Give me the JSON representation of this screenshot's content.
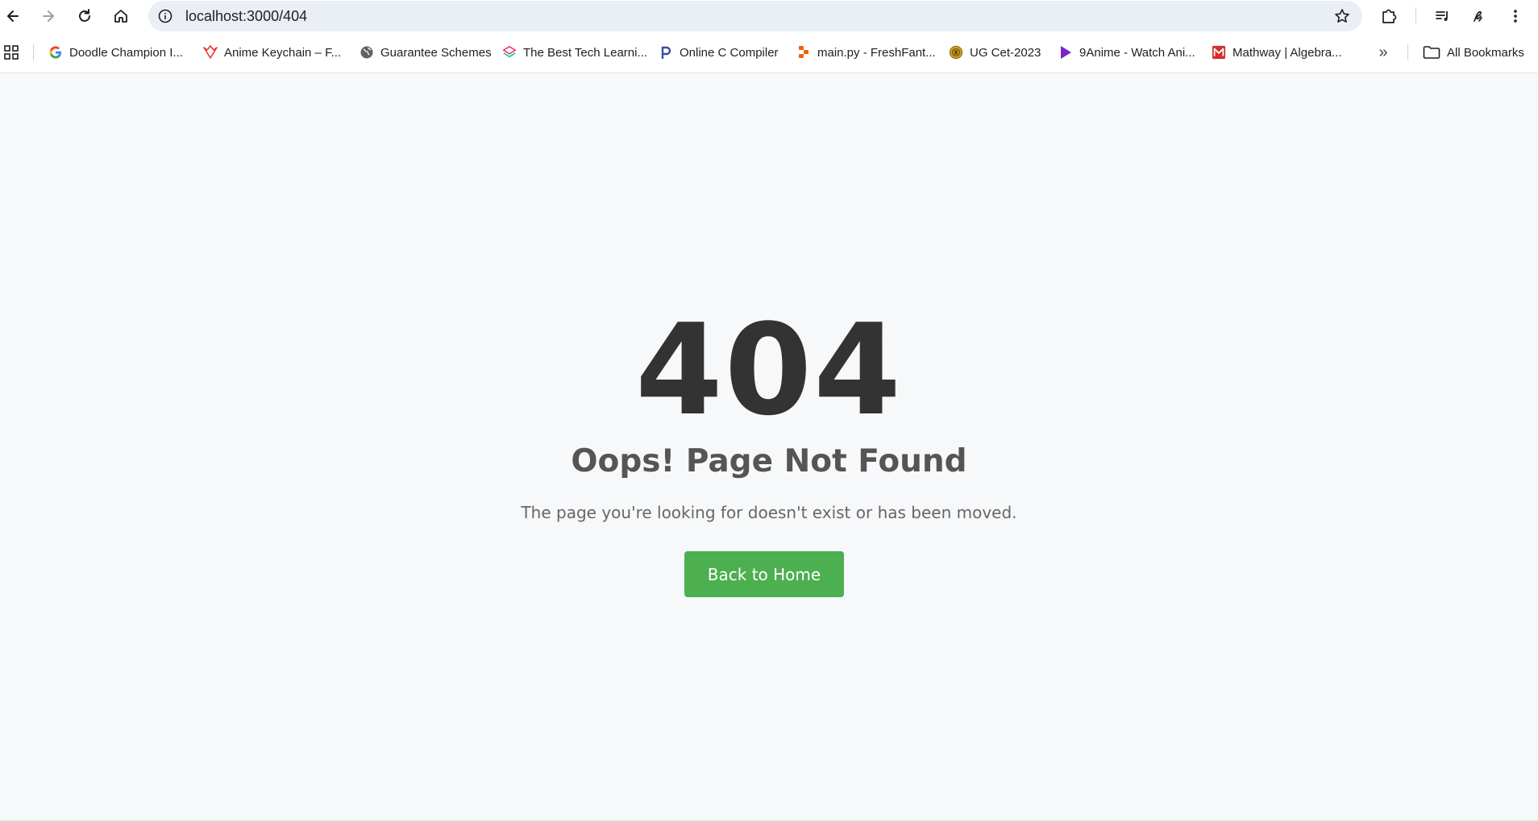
{
  "browser": {
    "url": "localhost:3000/404",
    "icons": {
      "back": "arrow-left-icon",
      "forward": "arrow-right-icon",
      "reload": "reload-icon",
      "home": "home-icon",
      "site_info": "info-icon",
      "bookmark_star": "star-icon",
      "extensions": "puzzle-icon",
      "media": "media-queue-icon",
      "profile": "profile-icon",
      "menu": "kebab-menu-icon"
    }
  },
  "bookmarks": {
    "items": [
      {
        "label": "Doodle Champion I...",
        "icon": "google-icon"
      },
      {
        "label": "Anime Keychain – F...",
        "icon": "anime-keychain-icon"
      },
      {
        "label": "Guarantee Schemes",
        "icon": "globe-icon"
      },
      {
        "label": "The Best Tech Learni...",
        "icon": "tech-learning-icon"
      },
      {
        "label": "Online C Compiler",
        "icon": "compiler-icon"
      },
      {
        "label": "main.py - FreshFant...",
        "icon": "replit-icon"
      },
      {
        "label": "UG Cet-2023",
        "icon": "emblem-icon"
      },
      {
        "label": "9Anime - Watch Ani...",
        "icon": "play-icon"
      },
      {
        "label": "Mathway | Algebra...",
        "icon": "mathway-icon"
      }
    ],
    "overflow": "»",
    "all_bookmarks": "All Bookmarks"
  },
  "page": {
    "code": "404",
    "title": "Oops! Page Not Found",
    "description": "The page you're looking for doesn't exist or has been moved.",
    "button_label": "Back to Home"
  },
  "colors": {
    "button": "#4caf50",
    "code_text": "#333333",
    "title_text": "#555555",
    "description_text": "#666666",
    "page_background": "#f7f8fa"
  }
}
